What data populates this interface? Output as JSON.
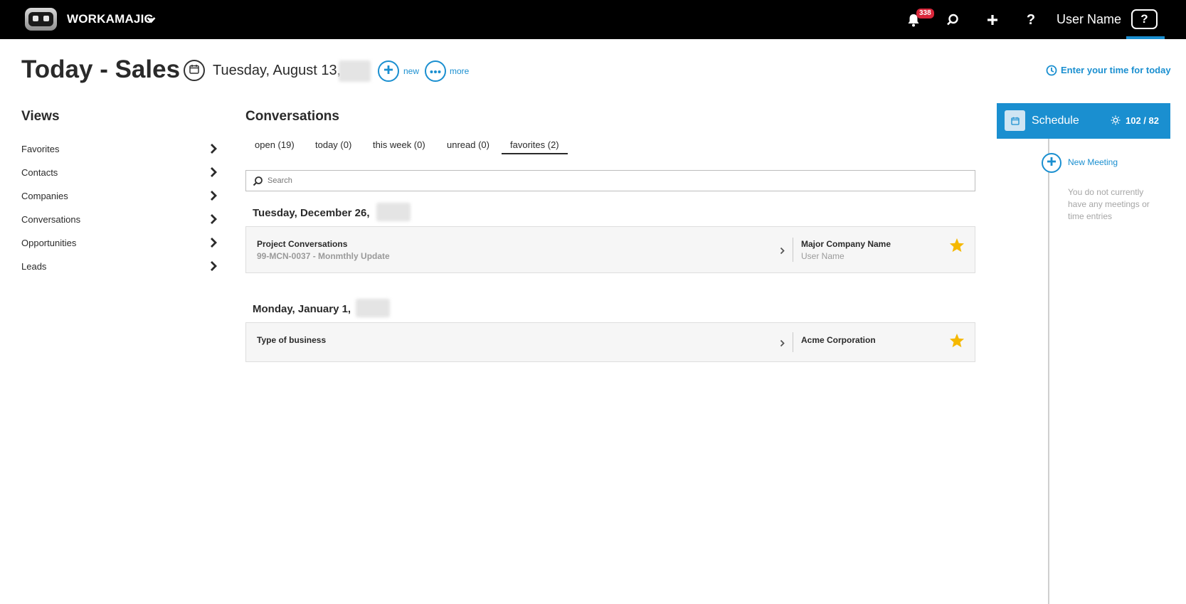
{
  "topbar": {
    "brand": "WORKAMAJIG",
    "notifications_count": "338",
    "username": "User Name",
    "help_label": "?"
  },
  "header": {
    "title": "Today - Sales",
    "date": "Tuesday, August 13,",
    "new_label": "new",
    "more_label": "more",
    "time_link": "Enter your time for today"
  },
  "views": {
    "title": "Views",
    "items": [
      "Favorites",
      "Contacts",
      "Companies",
      "Conversations",
      "Opportunities",
      "Leads"
    ]
  },
  "conversations": {
    "title": "Conversations",
    "tabs": [
      "open (19)",
      "today (0)",
      "this week (0)",
      "unread (0)",
      "favorites (2)"
    ],
    "active_tab": "favorites (2)",
    "search_placeholder": "Search",
    "groups": [
      {
        "date": "Tuesday, December 26,",
        "card": {
          "title": "Project Conversations",
          "subtitle": "99-MCN-0037 - Monmthly Update",
          "company": "Major Company Name",
          "person": "User Name",
          "favorite": true
        }
      },
      {
        "date": "Monday, January 1,",
        "card": {
          "title": "Type of business",
          "subtitle": "",
          "company": "Acme Corporation",
          "person": "",
          "favorite": true
        }
      }
    ]
  },
  "schedule": {
    "title": "Schedule",
    "count": "102 / 82",
    "new_meeting": "New Meeting",
    "empty_message": "You do not currently have any meetings or time entries"
  },
  "colors": {
    "accent": "#1a8fd0",
    "topbar": "#000000",
    "badge": "#d9263a",
    "star": "#f5b800"
  }
}
